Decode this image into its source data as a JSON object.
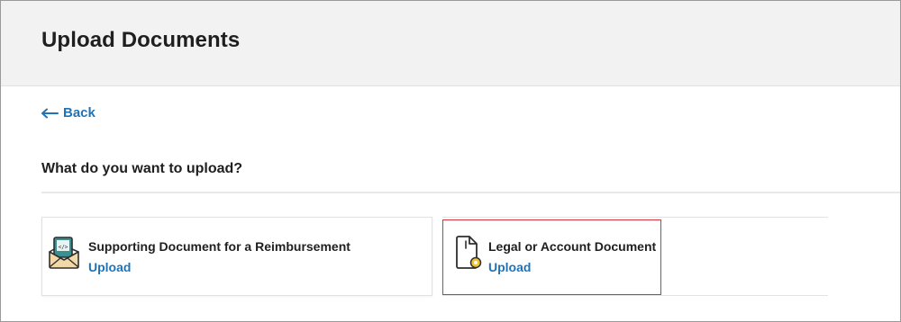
{
  "header": {
    "title": "Upload Documents"
  },
  "nav": {
    "back_label": "Back"
  },
  "main": {
    "question": "What do you want to upload?",
    "options": [
      {
        "title": "Supporting Document for a Reimbursement",
        "action_label": "Upload",
        "icon": "envelope-document-icon"
      },
      {
        "title": "Legal or Account Document",
        "action_label": "Upload",
        "icon": "document-seal-icon"
      }
    ]
  },
  "colors": {
    "link": "#1f73b7",
    "header_bg": "#f2f2f2",
    "highlight": "#d9343a",
    "icon_accent": "#f2c233",
    "icon_teal": "#3a8f8f"
  }
}
